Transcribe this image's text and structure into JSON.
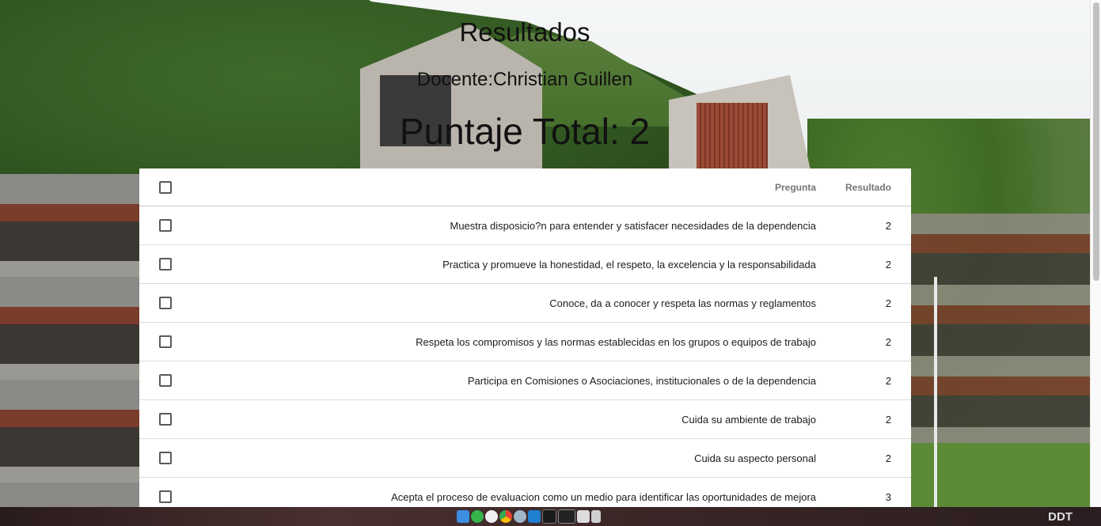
{
  "header": {
    "title": "Resultados",
    "teacher": "Docente:Christian Guillen",
    "total": "Puntaje Total: 2"
  },
  "table": {
    "columns": [
      "Pregunta",
      "Resultado"
    ],
    "rows": [
      {
        "question": "Muestra disposicio?n para entender y satisfacer necesidades de la dependencia",
        "result": "2"
      },
      {
        "question": "Practica y promueve la honestidad, el respeto, la excelencia y la responsabilidada",
        "result": "2"
      },
      {
        "question": "Conoce, da a conocer y respeta las normas y reglamentos",
        "result": "2"
      },
      {
        "question": "Respeta los compromisos y las normas establecidas en los grupos o equipos de trabajo",
        "result": "2"
      },
      {
        "question": "Participa en Comisiones o Asociaciones, institucionales o de la dependencia",
        "result": "2"
      },
      {
        "question": "Cuida su ambiente de trabajo",
        "result": "2"
      },
      {
        "question": "Cuida su aspecto personal",
        "result": "2"
      },
      {
        "question": "Acepta el proceso de evaluacion como un medio para identificar las oportunidades de mejora",
        "result": "3"
      }
    ]
  },
  "taskbar": {
    "label": "DDT",
    "dock_icons": [
      "finder-icon",
      "whatsapp-icon",
      "github-icon",
      "chrome-icon",
      "app-icon",
      "vscode-icon",
      "terminal-icon",
      "monitor-icon",
      "screen-icon",
      "trash-icon"
    ]
  }
}
